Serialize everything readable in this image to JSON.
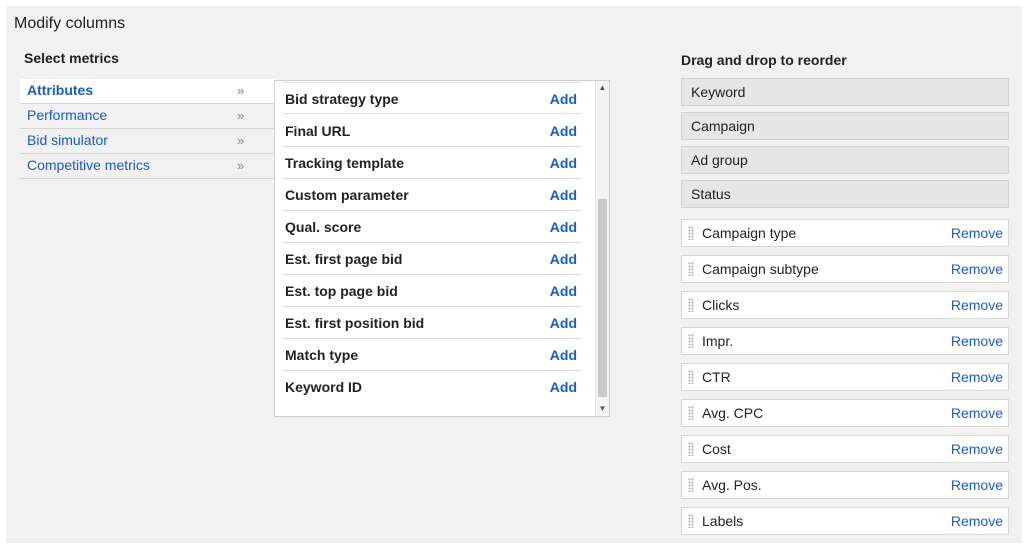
{
  "dialog": {
    "title": "Modify columns"
  },
  "select_metrics": {
    "title": "Select metrics",
    "chevron": "»",
    "categories": [
      {
        "label": "Attributes",
        "active": true
      },
      {
        "label": "Performance",
        "active": false
      },
      {
        "label": "Bid simulator",
        "active": false
      },
      {
        "label": "Competitive metrics",
        "active": false
      }
    ],
    "add_label": "Add",
    "metrics": [
      "Bid strategy type",
      "Final URL",
      "Tracking template",
      "Custom parameter",
      "Qual. score",
      "Est. first page bid",
      "Est. top page bid",
      "Est. first position bid",
      "Match type",
      "Keyword ID"
    ],
    "scroll_up_glyph": "▲",
    "scroll_down_glyph": "▼"
  },
  "reorder": {
    "title": "Drag and drop to reorder",
    "remove_label": "Remove",
    "fixed_columns": [
      "Keyword",
      "Campaign",
      "Ad group",
      "Status"
    ],
    "columns": [
      "Campaign type",
      "Campaign subtype",
      "Clicks",
      "Impr.",
      "CTR",
      "Avg. CPC",
      "Cost",
      "Avg. Pos.",
      "Labels"
    ]
  },
  "colors": {
    "link": "#1a5ad0",
    "panel_bg": "#f1f1f1"
  }
}
